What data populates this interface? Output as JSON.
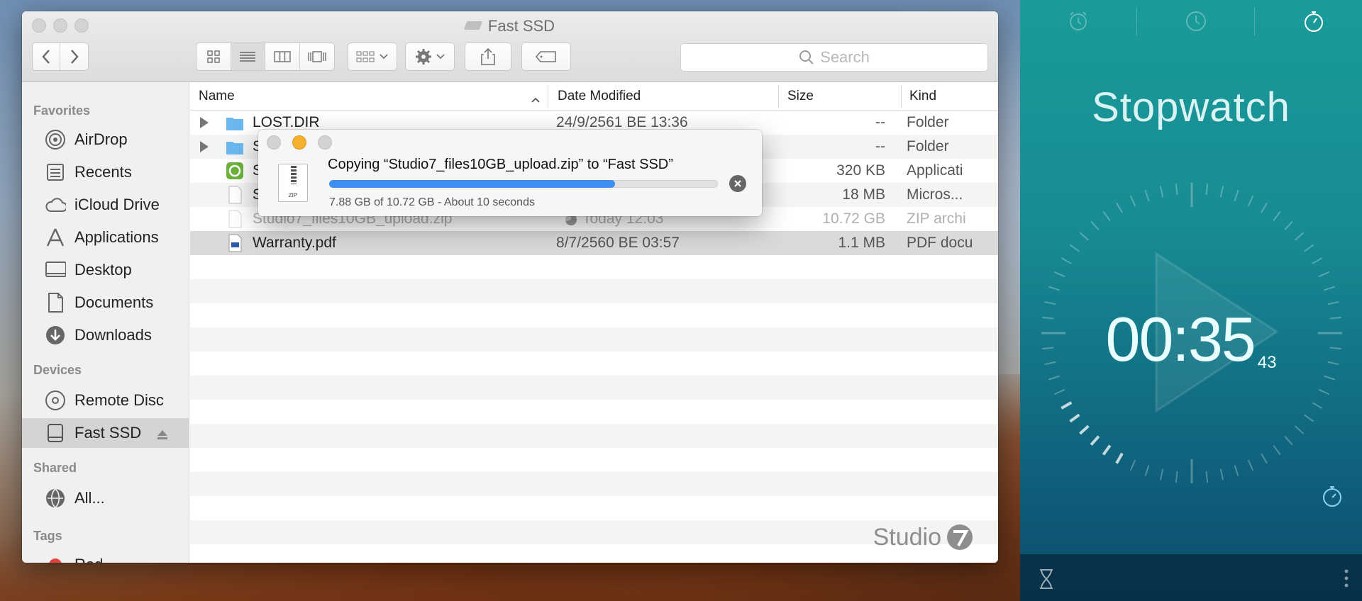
{
  "finder": {
    "title": "Fast SSD",
    "search_placeholder": "Search",
    "sidebar": {
      "favorites_heading": "Favorites",
      "favorites": [
        "AirDrop",
        "Recents",
        "iCloud Drive",
        "Applications",
        "Desktop",
        "Documents",
        "Downloads"
      ],
      "devices_heading": "Devices",
      "devices": [
        "Remote Disc",
        "Fast SSD"
      ],
      "shared_heading": "Shared",
      "shared": [
        "All..."
      ],
      "tags_heading": "Tags",
      "tags": [
        "Red"
      ]
    },
    "columns": {
      "name": "Name",
      "date": "Date Modified",
      "size": "Size",
      "kind": "Kind"
    },
    "rows": [
      {
        "name": "LOST.DIR",
        "date": "24/9/2561 BE 13:36",
        "size": "--",
        "kind": "Folder"
      },
      {
        "name": "S",
        "date": "",
        "size": "--",
        "kind": "Folder"
      },
      {
        "name": "S",
        "date": "",
        "size": "320 KB",
        "kind": "Applicati"
      },
      {
        "name": "S",
        "date": "",
        "size": "18 MB",
        "kind": "Micros..."
      },
      {
        "name": "Studio7_files10GB_upload.zip",
        "date": "Today 12:03",
        "size": "10.72 GB",
        "kind": "ZIP archi"
      },
      {
        "name": "Warranty.pdf",
        "date": "8/7/2560 BE 03:57",
        "size": "1.1 MB",
        "kind": "PDF docu"
      }
    ],
    "watermark": "Studio"
  },
  "copy_dialog": {
    "message": "Copying “Studio7_files10GB_upload.zip” to “Fast SSD”",
    "status": "7.88 GB of 10.72 GB - About 10 seconds",
    "progress_percent": 73.5,
    "file_icon_label": "ZIP"
  },
  "stopwatch": {
    "title": "Stopwatch",
    "time": "00:35",
    "hundredths": "43"
  },
  "colors": {
    "progress": "#3d8ef0",
    "stopwatch_bg": "#178a93"
  }
}
